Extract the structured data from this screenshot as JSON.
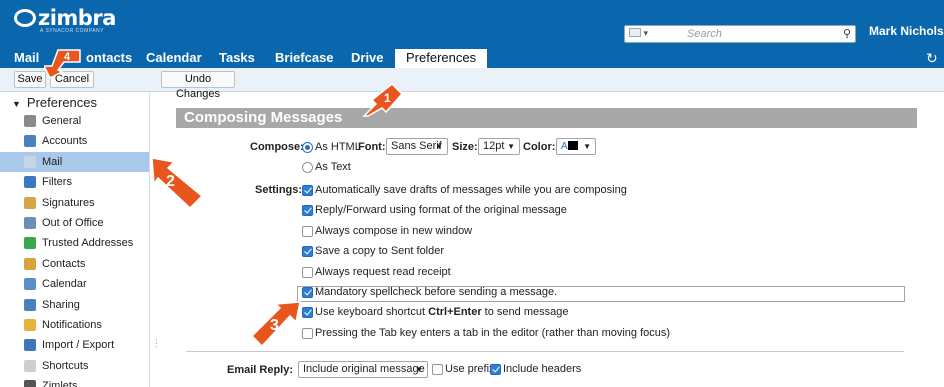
{
  "header": {
    "logo": "zimbra",
    "logo_sub": "A SYNACOR COMPANY",
    "search_placeholder": "Search",
    "user_name": "Mark Nichols"
  },
  "tabs": [
    {
      "label": "Mail"
    },
    {
      "label": "ontacts"
    },
    {
      "label": "Calendar"
    },
    {
      "label": "Tasks"
    },
    {
      "label": "Briefcase"
    },
    {
      "label": "Drive"
    },
    {
      "label": "Preferences",
      "active": true
    }
  ],
  "toolbar": {
    "save": "Save",
    "cancel": "Cancel",
    "undo": "Undo Changes"
  },
  "sidebar": {
    "title": "Preferences",
    "items": [
      {
        "label": "General",
        "icon": "gear-icon",
        "color": "#8a8a8a"
      },
      {
        "label": "Accounts",
        "icon": "accounts-icon",
        "color": "#4a7fc0"
      },
      {
        "label": "Mail",
        "icon": "mail-icon",
        "color": "#c7d4e2",
        "selected": true
      },
      {
        "label": "Filters",
        "icon": "filter-icon",
        "color": "#3b78c2"
      },
      {
        "label": "Signatures",
        "icon": "signature-icon",
        "color": "#d6a64b"
      },
      {
        "label": "Out of Office",
        "icon": "out-of-office-icon",
        "color": "#6b8fb8"
      },
      {
        "label": "Trusted Addresses",
        "icon": "shield-icon",
        "color": "#3aa84a"
      },
      {
        "label": "Contacts",
        "icon": "contacts-icon",
        "color": "#d8a23c"
      },
      {
        "label": "Calendar",
        "icon": "calendar-icon",
        "color": "#5b8fc9"
      },
      {
        "label": "Sharing",
        "icon": "sharing-icon",
        "color": "#4a7fc0"
      },
      {
        "label": "Notifications",
        "icon": "bell-icon",
        "color": "#e6b33a"
      },
      {
        "label": "Import / Export",
        "icon": "import-export-icon",
        "color": "#3f76b8"
      },
      {
        "label": "Shortcuts",
        "icon": "keyboard-icon",
        "color": "#cfcfcf"
      },
      {
        "label": "Zimlets",
        "icon": "zimlets-icon",
        "color": "#555555"
      }
    ]
  },
  "main": {
    "section_title": "Composing Messages",
    "compose_label": "Compose:",
    "as_html": "As HTML",
    "as_text": "As Text",
    "font_label": "Font:",
    "font_value": "Sans Serif",
    "size_label": "Size:",
    "size_value": "12pt",
    "color_label": "Color:",
    "settings_label": "Settings:",
    "settings": [
      {
        "label": "Automatically save drafts of messages while you are composing",
        "checked": true
      },
      {
        "label": "Reply/Forward using format of the original message",
        "checked": true
      },
      {
        "label": "Always compose in new window",
        "checked": false
      },
      {
        "label": "Save a copy to Sent folder",
        "checked": true
      },
      {
        "label": "Always request read receipt",
        "checked": false
      },
      {
        "label": "Mandatory spellcheck before sending a message.",
        "checked": true
      },
      {
        "label_pre": "Use keyboard shortcut ",
        "label_bold": "Ctrl+Enter",
        "label_post": " to send message",
        "checked": true
      },
      {
        "label": "Pressing the Tab key enters a tab in the editor (rather than moving focus)",
        "checked": false
      }
    ],
    "email_reply_label": "Email Reply:",
    "email_reply_value": "Include original message",
    "use_prefix": "Use prefix",
    "include_headers": "Include headers"
  },
  "callouts": [
    "1",
    "2",
    "3",
    "4"
  ],
  "colors": {
    "header_blue": "#0a66ad",
    "selected_item": "#a9c8ea",
    "section_bar": "#a8a8a8",
    "callout_orange": "#e8561e"
  }
}
